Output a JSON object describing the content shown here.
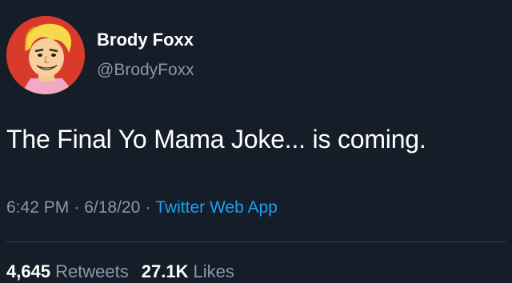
{
  "author": {
    "name": "Brody Foxx",
    "handle": "@BrodyFoxx",
    "avatar_icon": "cartoon-portrait-avatar"
  },
  "tweet": {
    "text": "The Final Yo Mama Joke... is coming."
  },
  "meta": {
    "time": "6:42 PM",
    "separator": "·",
    "date": "6/18/20",
    "source": "Twitter Web App"
  },
  "stats": {
    "retweets_count": "4,645",
    "retweets_label": "Retweets",
    "likes_count": "27.1K",
    "likes_label": "Likes"
  },
  "colors": {
    "background": "#141d28",
    "secondary_text": "#8899a6",
    "link": "#1da1f2",
    "avatar_bg": "#d93a2a"
  }
}
